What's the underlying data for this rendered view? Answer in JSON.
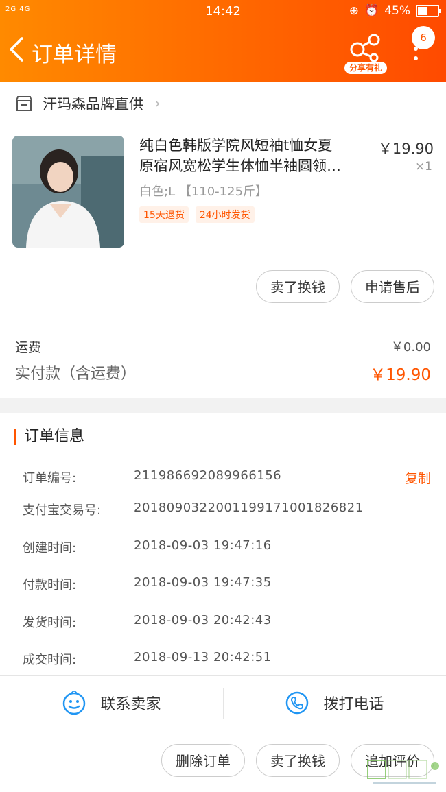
{
  "status_bar": {
    "network": "2G 4G",
    "time": "14:42",
    "battery": "45%",
    "battery_level": 0.45
  },
  "nav": {
    "title": "订单详情",
    "share_label": "分享有礼",
    "cart_count": "6"
  },
  "shop": {
    "name": "汗玛森品牌直供"
  },
  "item": {
    "title_line1": "纯白色韩版学院风短袖t恤女夏",
    "title_line2": "原宿风宽松学生体恤半袖圆领…",
    "price": "￥19.90",
    "qty": "×1",
    "sku": "白色;L 【110-125斤】",
    "tags": [
      "15天退货",
      "24小时发货"
    ]
  },
  "item_actions": {
    "sell": "卖了换钱",
    "after_sale": "申请售后"
  },
  "summary": {
    "shipping_label": "运费",
    "shipping_value": "￥0.00",
    "paid_label": "实付款（含运费）",
    "paid_value": "￥19.90"
  },
  "order_info": {
    "heading": "订单信息",
    "copy_label": "复制",
    "rows": [
      {
        "label": "订单编号:",
        "value": "211986692089966156"
      },
      {
        "label": "支付宝交易号:",
        "value": "2018090322001199171001826821"
      },
      {
        "label": "创建时间:",
        "value": "2018-09-03 19:47:16"
      },
      {
        "label": "付款时间:",
        "value": "2018-09-03 19:47:35"
      },
      {
        "label": "发货时间:",
        "value": "2018-09-03 20:42:43"
      },
      {
        "label": "成交时间:",
        "value": "2018-09-13 20:42:51"
      }
    ]
  },
  "contact": {
    "seller": "联系卖家",
    "call": "拨打电话"
  },
  "bottom_actions": {
    "delete": "删除订单",
    "sell": "卖了换钱",
    "review": "追加评价"
  },
  "colors": {
    "accent": "#ff5500",
    "header_start": "#ff8a00",
    "header_end": "#ff4a00",
    "link_blue": "#2196f3"
  },
  "icons": {
    "back": "chevron-left-icon",
    "share": "share-icon",
    "more": "more-vertical-icon",
    "shop": "store-icon",
    "chat": "chat-icon",
    "phone": "phone-icon"
  }
}
